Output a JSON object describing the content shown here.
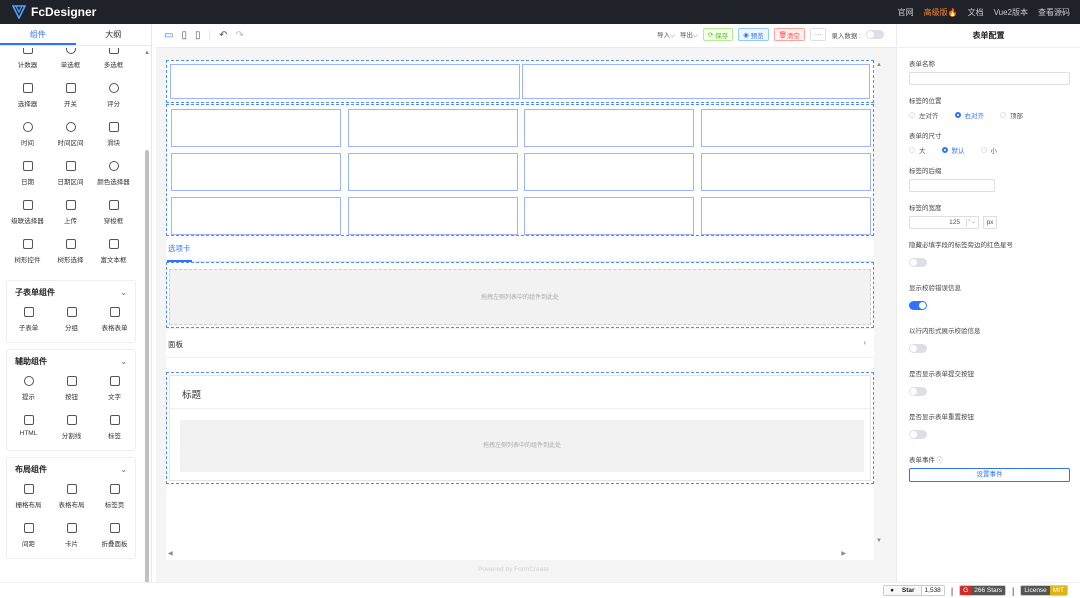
{
  "app": {
    "title": "FcDesigner",
    "nav": [
      {
        "label": "官网"
      },
      {
        "label": "高级版🔥"
      },
      {
        "label": "文档"
      },
      {
        "label": "Vue2版本"
      },
      {
        "label": "查看源码"
      }
    ]
  },
  "left": {
    "tabs": [
      {
        "label": "组件"
      },
      {
        "label": "大纲"
      }
    ],
    "basic_items": [
      {
        "icon": "counter-icon",
        "label": "计数器"
      },
      {
        "icon": "radio-icon",
        "label": "单选框"
      },
      {
        "icon": "checkbox-icon",
        "label": "多选框"
      },
      {
        "icon": "select-icon",
        "label": "选择器"
      },
      {
        "icon": "switch-icon",
        "label": "开关"
      },
      {
        "icon": "star-icon",
        "label": "评分"
      },
      {
        "icon": "clock-icon",
        "label": "时间"
      },
      {
        "icon": "clock-range-icon",
        "label": "时间区间"
      },
      {
        "icon": "slider-icon",
        "label": "滑块"
      },
      {
        "icon": "calendar-icon",
        "label": "日期"
      },
      {
        "icon": "calendar-range-icon",
        "label": "日期区间"
      },
      {
        "icon": "palette-icon",
        "label": "颜色选择器"
      },
      {
        "icon": "cascader-icon",
        "label": "级联选择器"
      },
      {
        "icon": "upload-icon",
        "label": "上传"
      },
      {
        "icon": "transfer-icon",
        "label": "穿梭框"
      },
      {
        "icon": "tree-icon",
        "label": "树形控件"
      },
      {
        "icon": "tree-select-icon",
        "label": "树形选择"
      },
      {
        "icon": "editor-icon",
        "label": "富文本框"
      }
    ],
    "groups": [
      {
        "title": "子表单组件",
        "items": [
          {
            "icon": "subform-icon",
            "label": "子表单"
          },
          {
            "icon": "group-icon",
            "label": "分组"
          },
          {
            "icon": "table-form-icon",
            "label": "表格表单"
          }
        ]
      },
      {
        "title": "辅助组件",
        "items": [
          {
            "icon": "info-icon",
            "label": "提示"
          },
          {
            "icon": "button-icon",
            "label": "按钮"
          },
          {
            "icon": "text-icon",
            "label": "文字"
          },
          {
            "icon": "html-icon",
            "label": "HTML"
          },
          {
            "icon": "divider-icon",
            "label": "分割线"
          },
          {
            "icon": "tag-icon",
            "label": "标签"
          }
        ]
      },
      {
        "title": "布局组件",
        "items": [
          {
            "icon": "grid-icon",
            "label": "栅格布局"
          },
          {
            "icon": "table-layout-icon",
            "label": "表格布局"
          },
          {
            "icon": "tabs-icon",
            "label": "标签页"
          },
          {
            "icon": "space-icon",
            "label": "间距"
          },
          {
            "icon": "card-icon",
            "label": "卡片"
          },
          {
            "icon": "collapse-icon",
            "label": "折叠面板"
          }
        ]
      }
    ]
  },
  "toolbar": {
    "import_label": "导入",
    "export_label": "导出",
    "save_label": "保存",
    "preview_label": "预览",
    "clear_label": "清空",
    "more_label": "···",
    "entry_label": "录入数据 :"
  },
  "canvas": {
    "tab_label": "选项卡",
    "drop_hint": "拖拽左侧列表中的组件到此处",
    "panel_label": "面板",
    "card_title": "标题",
    "drop_hint_2": "拖拽左侧列表中的组件到此处",
    "powered": "Powered by FormCreate"
  },
  "right": {
    "title": "表单配置",
    "form_name_label": "表单名称",
    "label_position_label": "标签的位置",
    "label_position_options": [
      {
        "label": "左对齐",
        "selected": false
      },
      {
        "label": "右对齐",
        "selected": true
      },
      {
        "label": "顶部",
        "selected": false
      }
    ],
    "size_label": "表单的尺寸",
    "size_options": [
      {
        "label": "大",
        "selected": false
      },
      {
        "label": "默认",
        "selected": true
      },
      {
        "label": "小",
        "selected": false
      }
    ],
    "suffix_label": "标签的后缀",
    "width_label": "标签的宽度",
    "width_value": "125",
    "width_unit": "px",
    "hide_star_label": "隐藏必填字段的标签旁边的红色星号",
    "hide_star_on": false,
    "show_error_label": "显示校验错误信息",
    "show_error_on": true,
    "inline_msg_label": "以行内形式展示校验信息",
    "inline_msg_on": false,
    "submit_btn_label": "是否显示表单提交按钮",
    "submit_btn_on": false,
    "reset_btn_label": "是否显示表单重置按钮",
    "reset_btn_on": false,
    "events_label": "表单事件",
    "events_button": "设置事件"
  },
  "footer": {
    "star_label": "Star",
    "star_count": "1,538",
    "stars_text": "266 Stars",
    "license_label": "License",
    "license_value": "MIT"
  }
}
